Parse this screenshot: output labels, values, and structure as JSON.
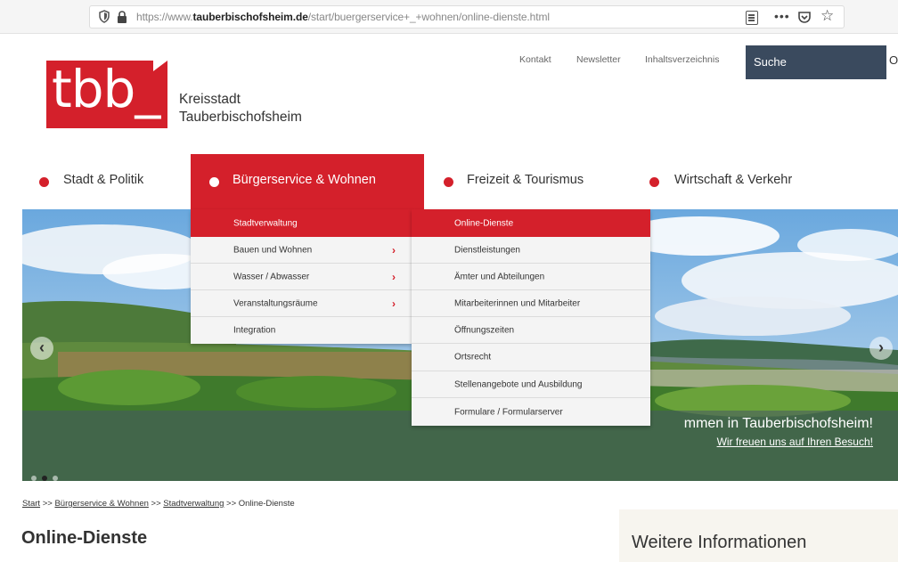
{
  "browser": {
    "url_prefix": "https://www.",
    "url_domain": "tauberbischofsheim.de",
    "url_path": "/start/buergerservice+_+wohnen/online-dienste.html"
  },
  "header": {
    "logo_text": "tbb_",
    "city_line1": "Kreisstadt",
    "city_line2": "Tauberbischofsheim",
    "toplinks": [
      "Kontakt",
      "Newsletter",
      "Inhaltsverzeichnis"
    ],
    "search_label": "Suche"
  },
  "nav": {
    "items": [
      {
        "label": "Stadt & Politik"
      },
      {
        "label": "Bürgerservice & Wohnen",
        "active": true
      },
      {
        "label": "Freizeit & Tourismus"
      },
      {
        "label": "Wirtschaft & Verkehr"
      }
    ]
  },
  "dropdown": {
    "left": [
      {
        "label": "Stadtverwaltung",
        "active": true
      },
      {
        "label": "Bauen und Wohnen",
        "has_sub": true
      },
      {
        "label": "Wasser / Abwasser",
        "has_sub": true
      },
      {
        "label": "Veranstaltungsräume",
        "has_sub": true
      },
      {
        "label": "Integration"
      }
    ],
    "right": [
      {
        "label": "Online-Dienste",
        "active": true
      },
      {
        "label": "Dienstleistungen"
      },
      {
        "label": "Ämter und Abteilungen"
      },
      {
        "label": "Mitarbeiterinnen und Mitarbeiter"
      },
      {
        "label": "Öffnungszeiten"
      },
      {
        "label": "Ortsrecht"
      },
      {
        "label": "Stellenangebote und Ausbildung"
      },
      {
        "label": "Formulare / Formularserver"
      }
    ]
  },
  "hero": {
    "title": "mmen in Tauberbischofsheim!",
    "subtitle": "Wir freuen uns auf Ihren Besuch!"
  },
  "breadcrumb": {
    "items": [
      "Start",
      "Bürgerservice & Wohnen",
      "Stadtverwaltung",
      "Online-Dienste"
    ],
    "separator": ">>"
  },
  "main": {
    "title": "Online-Dienste"
  },
  "sidebar": {
    "title": "Weitere Informationen"
  },
  "colors": {
    "brand_red": "#d4202b",
    "search_bg": "#3a4a5e"
  }
}
